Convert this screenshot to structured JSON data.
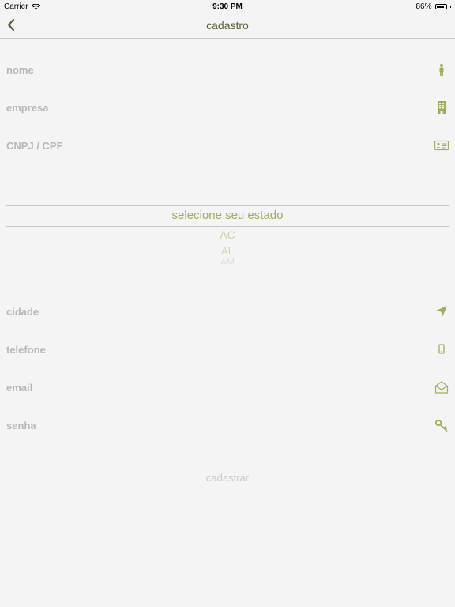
{
  "status_bar": {
    "carrier": "Carrier",
    "time": "9:30 PM",
    "battery": "86%",
    "battery_level": 0.86
  },
  "nav": {
    "title": "cadastro"
  },
  "fields": {
    "nome": {
      "label": "nome",
      "icon": "person-icon"
    },
    "empresa": {
      "label": "empresa",
      "icon": "building-icon"
    },
    "cnpj": {
      "label": "CNPJ / CPF",
      "icon": "id-card-icon"
    },
    "cidade": {
      "label": "cidade",
      "icon": "location-arrow-icon"
    },
    "telefone": {
      "label": "telefone",
      "icon": "phone-icon"
    },
    "email": {
      "label": "email",
      "icon": "envelope-open-icon"
    },
    "senha": {
      "label": "senha",
      "icon": "key-icon"
    }
  },
  "state_picker": {
    "selected": "selecione seu estado",
    "options": [
      "AC",
      "AL",
      "AM"
    ]
  },
  "submit_label": "cadastrar",
  "colors": {
    "accent": "#9fae5e",
    "title": "#5a6133",
    "label": "#b7b7b7"
  }
}
